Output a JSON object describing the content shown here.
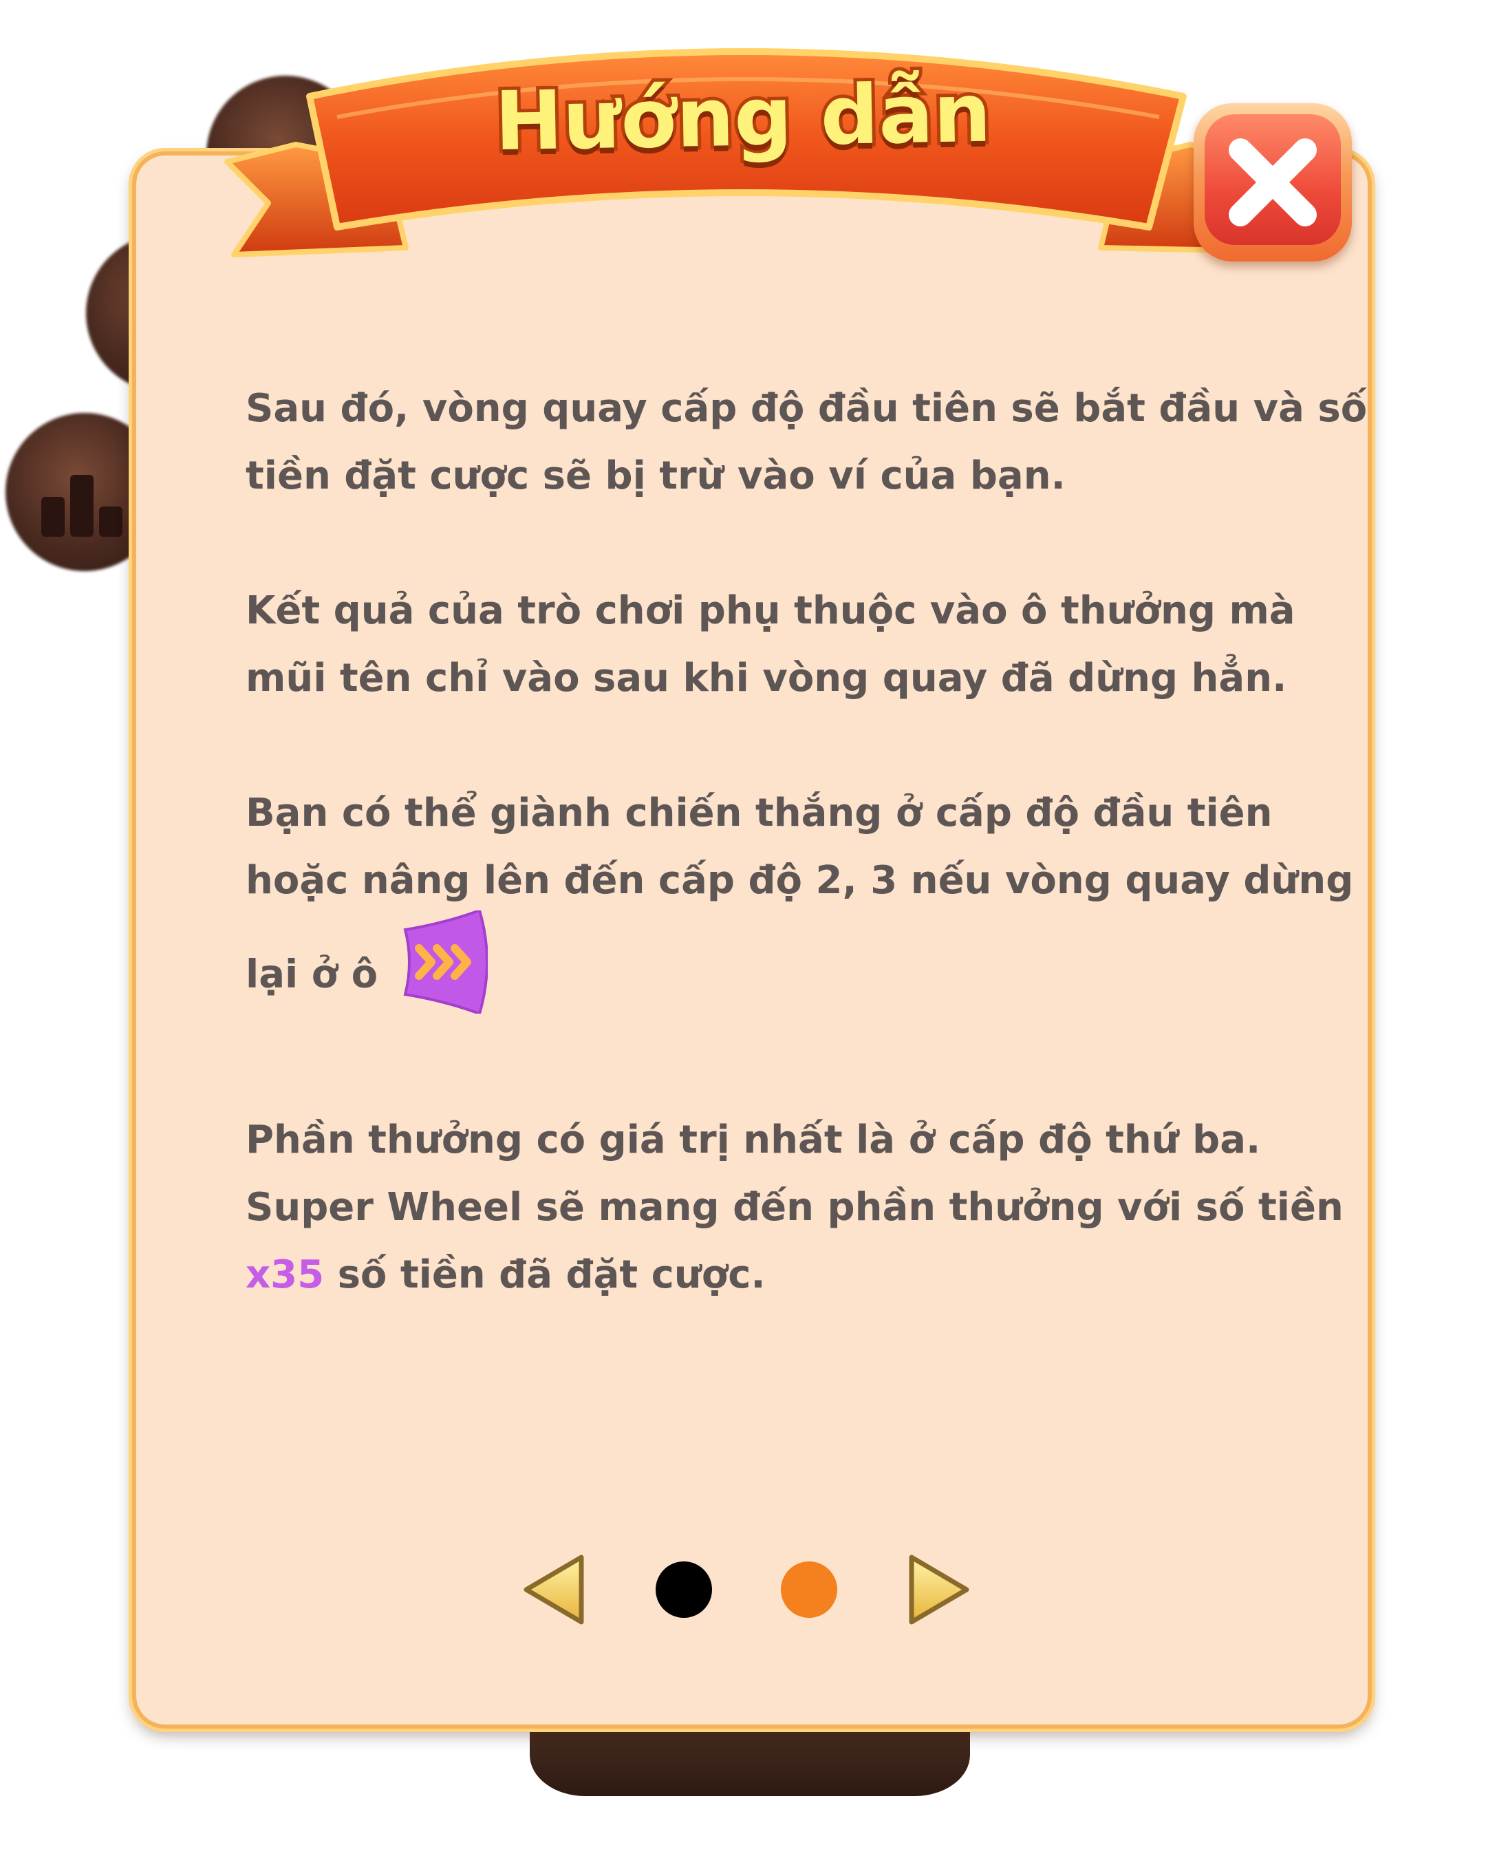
{
  "dialog": {
    "title": "Hướng dẫn",
    "close_icon": "close-x-icon"
  },
  "content": {
    "paragraph_1": {
      "line_1": "Sau đó, vòng quay cấp độ đầu tiên sẽ bắt đầu và số",
      "line_2": "tiền đặt cược sẽ bị trừ vào ví của bạn."
    },
    "paragraph_2": {
      "line_1": "Kết quả của trò chơi phụ thuộc vào ô thưởng mà",
      "line_2": "mũi tên chỉ vào sau khi vòng quay đã dừng hẳn."
    },
    "paragraph_3": {
      "line_1": "Bạn có thể giành chiến thắng ở cấp độ đầu tiên",
      "line_2": "hoặc nâng lên đến cấp độ 2, 3 nếu vòng quay dừng",
      "line_3": "lại ở ô",
      "tile_icon": "level-up-chevrons-icon"
    },
    "paragraph_4": {
      "line_1": "Phần thưởng có giá trị nhất là ở cấp độ thứ ba.",
      "line_2": "Super Wheel sẽ mang đến phần thưởng với số tiền",
      "multiplier": "x35",
      "line_3_rest": "số tiền đã đặt cược."
    }
  },
  "pagination": {
    "total_pages": 2,
    "current_page": 2,
    "prev_icon": "triangle-left-icon",
    "next_icon": "triangle-right-icon"
  },
  "colors": {
    "panel_bg": "#fde3cc",
    "panel_border": "#f4b35a",
    "ribbon": "#ee4a18",
    "title_text": "#fff27a",
    "body_text": "#5d5654",
    "highlight": "#c65de6",
    "dot_inactive": "#000000",
    "dot_active": "#f4801e"
  }
}
